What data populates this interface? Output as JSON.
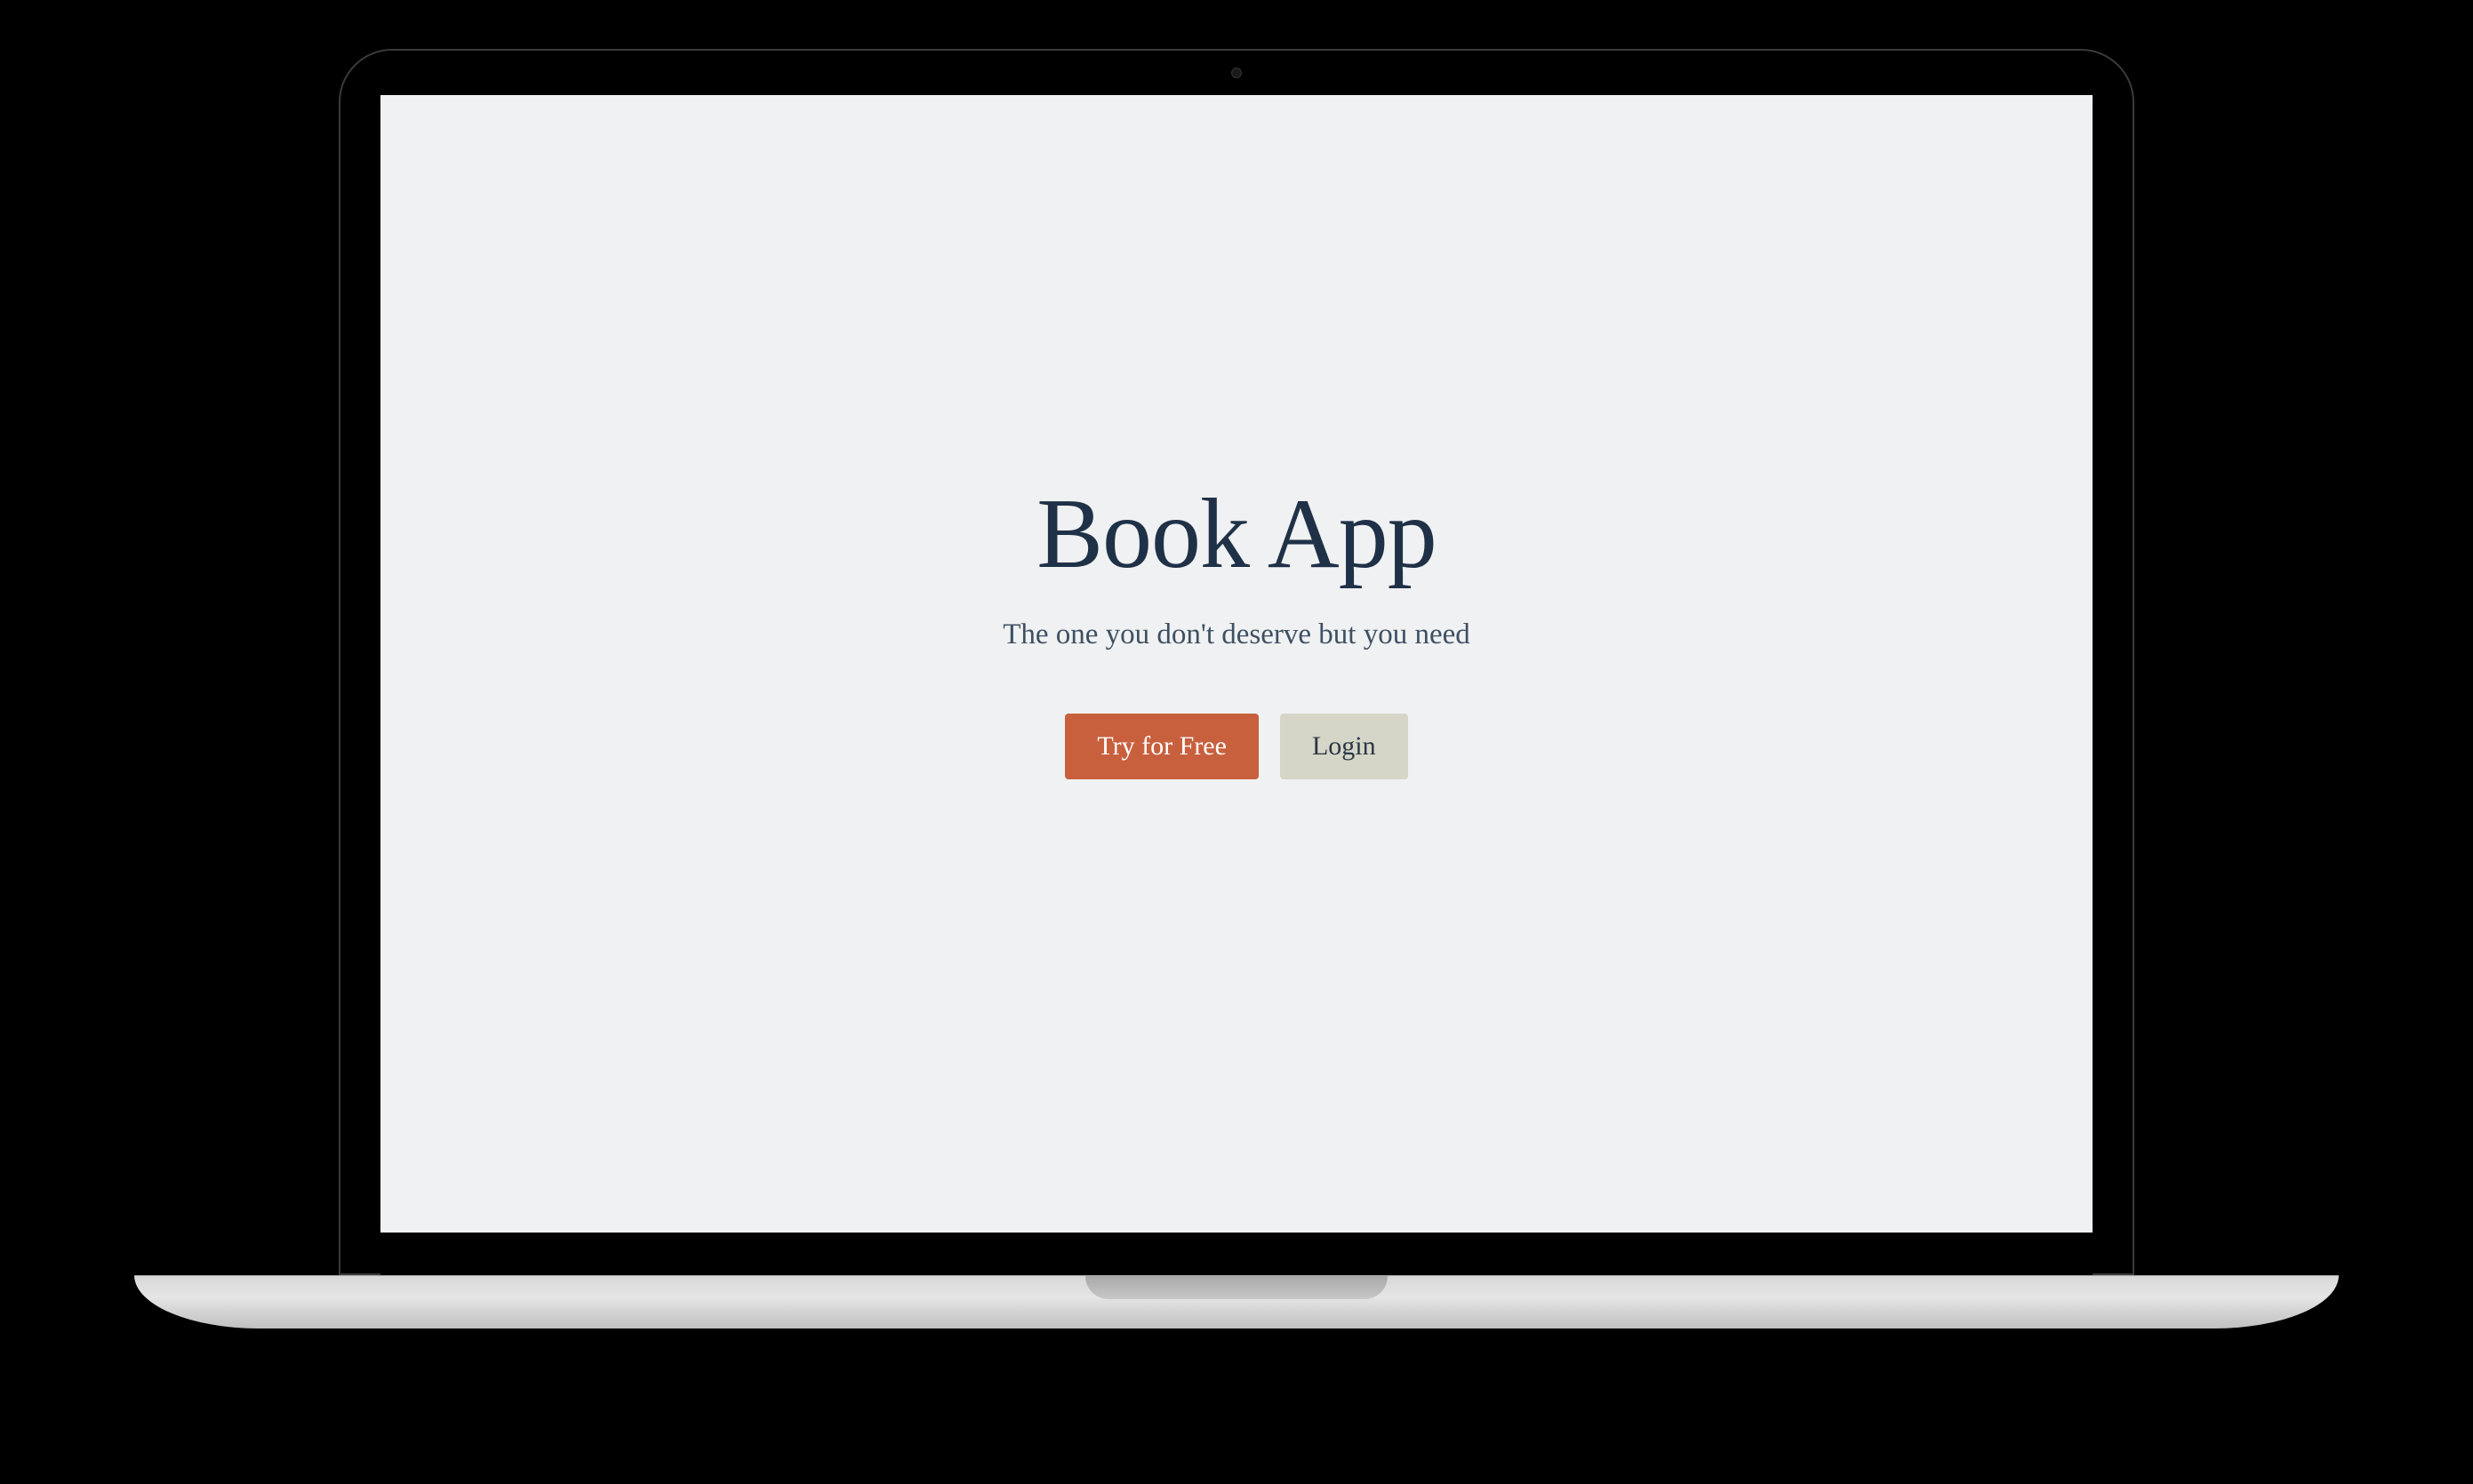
{
  "hero": {
    "title": "Book App",
    "tagline": "The one you don't deserve but you need",
    "primary_button_label": "Try for Free",
    "secondary_button_label": "Login"
  }
}
